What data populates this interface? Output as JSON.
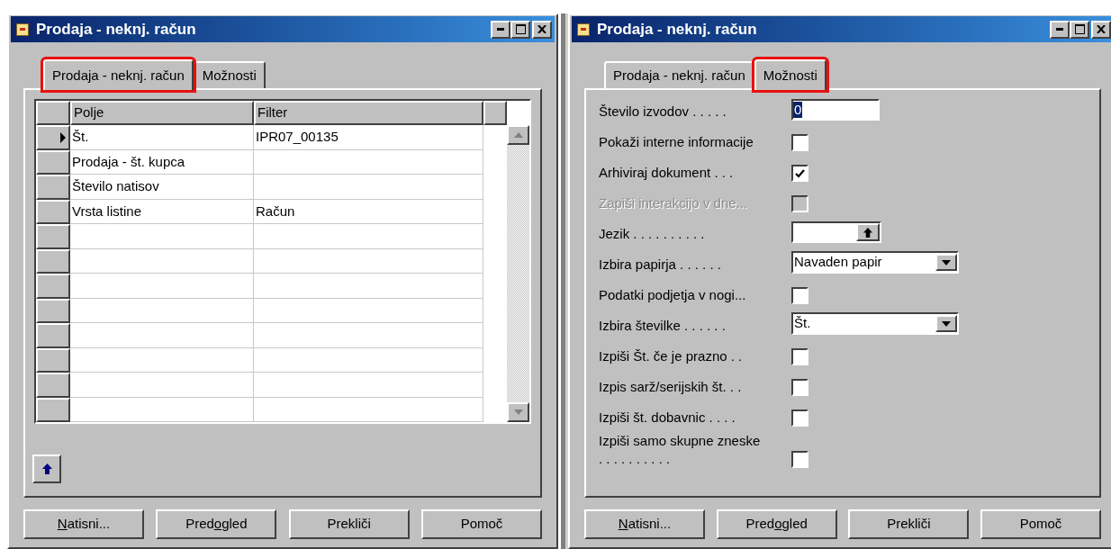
{
  "windows": [
    {
      "title": "Prodaja - neknj. račun",
      "tabs": [
        {
          "label": "Prodaja - neknj. račun",
          "selected": true,
          "highlighted": true
        },
        {
          "label": "Možnosti",
          "selected": false,
          "highlighted": false
        }
      ],
      "kind": "table",
      "table": {
        "columns": [
          "Polje",
          "Filter"
        ],
        "rows": [
          {
            "cells": [
              "Št.",
              "IPR07_00135"
            ],
            "selected": true
          },
          {
            "cells": [
              "Prodaja - št. kupca",
              ""
            ],
            "selected": false
          },
          {
            "cells": [
              "Število natisov",
              ""
            ],
            "selected": false
          },
          {
            "cells": [
              "Vrsta listine",
              "Račun"
            ],
            "selected": false
          },
          {
            "cells": [
              "",
              ""
            ],
            "selected": false
          },
          {
            "cells": [
              "",
              ""
            ],
            "selected": false
          },
          {
            "cells": [
              "",
              ""
            ],
            "selected": false
          },
          {
            "cells": [
              "",
              ""
            ],
            "selected": false
          },
          {
            "cells": [
              "",
              ""
            ],
            "selected": false
          },
          {
            "cells": [
              "",
              ""
            ],
            "selected": false
          },
          {
            "cells": [
              "",
              ""
            ],
            "selected": false
          },
          {
            "cells": [
              "",
              ""
            ],
            "selected": false
          }
        ]
      },
      "buttons": [
        {
          "parts": [
            {
              "text": "N",
              "underlined": true
            },
            {
              "text": "atisni...",
              "underlined": false
            }
          ]
        },
        {
          "parts": [
            {
              "text": "Pred",
              "underlined": false
            },
            {
              "text": "o",
              "underlined": true
            },
            {
              "text": "gled",
              "underlined": false
            }
          ]
        },
        {
          "parts": [
            {
              "text": "Prekliči",
              "underlined": false
            }
          ]
        },
        {
          "parts": [
            {
              "text": "Pomoč",
              "underlined": false
            }
          ]
        }
      ]
    },
    {
      "title": "Prodaja - neknj. račun",
      "tabs": [
        {
          "label": "Prodaja - neknj. račun",
          "selected": false,
          "highlighted": false
        },
        {
          "label": "Možnosti",
          "selected": true,
          "highlighted": true
        }
      ],
      "kind": "options",
      "options": [
        {
          "kind": "text",
          "label": "Število izvodov . . . . .",
          "value": "0",
          "disabled": false
        },
        {
          "kind": "checkbox",
          "label": "Pokaži interne informacije",
          "checked": false,
          "disabled": false
        },
        {
          "kind": "checkbox",
          "label": "Arhiviraj dokument . . .",
          "checked": true,
          "disabled": false
        },
        {
          "kind": "checkbox",
          "label": "Zapiši interakcijo v dne...",
          "checked": false,
          "disabled": true
        },
        {
          "kind": "lookup",
          "label": "Jezik . . . . . . . . . .",
          "disabled": false
        },
        {
          "kind": "dropdown",
          "label": "Izbira papirja . . . . . .",
          "value": "Navaden papir",
          "disabled": false
        },
        {
          "kind": "checkbox",
          "label": "Podatki podjetja v nogi...",
          "checked": false,
          "disabled": false
        },
        {
          "kind": "dropdown",
          "label": "Izbira številke . . . . . .",
          "value": "Št.",
          "disabled": false
        },
        {
          "kind": "checkbox",
          "label": "Izpiši Št. če je prazno . .",
          "checked": false,
          "disabled": false
        },
        {
          "kind": "checkbox",
          "label": "Izpis sarž/serijskih št. . .",
          "checked": false,
          "disabled": false
        },
        {
          "kind": "checkbox",
          "label": "Izpiši št. dobavnic . . . .",
          "checked": false,
          "disabled": false
        },
        {
          "kind": "checkbox",
          "label": "Izpiši samo skupne zneske . . . . . . . . . .",
          "checked": false,
          "disabled": false
        }
      ],
      "buttons": [
        {
          "parts": [
            {
              "text": "N",
              "underlined": true
            },
            {
              "text": "atisni...",
              "underlined": false
            }
          ]
        },
        {
          "parts": [
            {
              "text": "Pred",
              "underlined": false
            },
            {
              "text": "o",
              "underlined": true
            },
            {
              "text": "gled",
              "underlined": false
            }
          ]
        },
        {
          "parts": [
            {
              "text": "Prekliči",
              "underlined": false
            }
          ]
        },
        {
          "parts": [
            {
              "text": "Pomoč",
              "underlined": false
            }
          ]
        }
      ]
    }
  ]
}
